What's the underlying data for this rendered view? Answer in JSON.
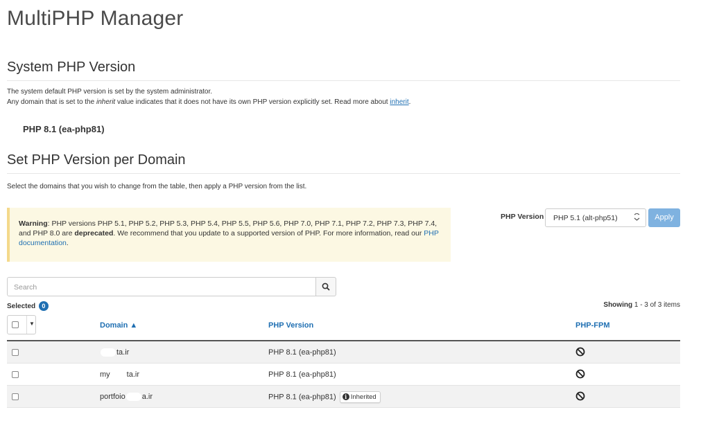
{
  "page": {
    "title": "MultiPHP Manager"
  },
  "system_section": {
    "title": "System PHP Version",
    "desc_line1": "The system default PHP version is set by the system administrator.",
    "desc_line2_pre": "Any domain that is set to the ",
    "desc_line2_em": "inherit",
    "desc_line2_mid": " value indicates that it does not have its own PHP version explicitly set. Read more about ",
    "desc_line2_link": "inherit",
    "desc_line2_post": ".",
    "current_version": "PHP 8.1 (ea-php81)"
  },
  "domain_section": {
    "title": "Set PHP Version per Domain",
    "desc": "Select the domains that you wish to change from the table, then apply a PHP version from the list."
  },
  "warning": {
    "label": "Warning",
    "text1": ": PHP versions PHP 5.1, PHP 5.2, PHP 5.3, PHP 5.4, PHP 5.5, PHP 5.6, PHP 7.0, PHP 7.1, PHP 7.2, PHP 7.3, PHP 7.4, and PHP 8.0 are ",
    "bold": "deprecated",
    "text2": ". We recommend that you update to a supported version of PHP. For more information, read our ",
    "link": "PHP documentation",
    "text3": "."
  },
  "version_picker": {
    "label": "PHP Version",
    "selected": "PHP 5.1 (alt-php51)",
    "apply_label": "Apply"
  },
  "search": {
    "placeholder": "Search"
  },
  "selection": {
    "label": "Selected",
    "count": "0"
  },
  "pagination": {
    "prefix": "Showing ",
    "range": "1 - 3 of 3",
    "suffix": " items"
  },
  "table": {
    "columns": {
      "domain": "Domain ▲",
      "php_version": "PHP Version",
      "php_fpm": "PHP-FPM"
    },
    "rows": [
      {
        "domain_pre": "",
        "domain_post": "ta.ir",
        "version": "PHP 8.1 (ea-php81)",
        "badge": ""
      },
      {
        "domain_pre": "my",
        "domain_post": "ta.ir",
        "version": "PHP 8.1 (ea-php81)",
        "badge": ""
      },
      {
        "domain_pre": "portfoio",
        "domain_post": "a.ir",
        "version": "PHP 8.1 (ea-php81)",
        "badge": "Inherited"
      }
    ]
  },
  "colors": {
    "link": "#1f6fb2",
    "warning_bg": "#fcf8e3",
    "apply_bg": "#7fb2e0"
  },
  "icons": {
    "search": "search-icon",
    "fpm": "ban-icon",
    "info": "info-icon"
  }
}
